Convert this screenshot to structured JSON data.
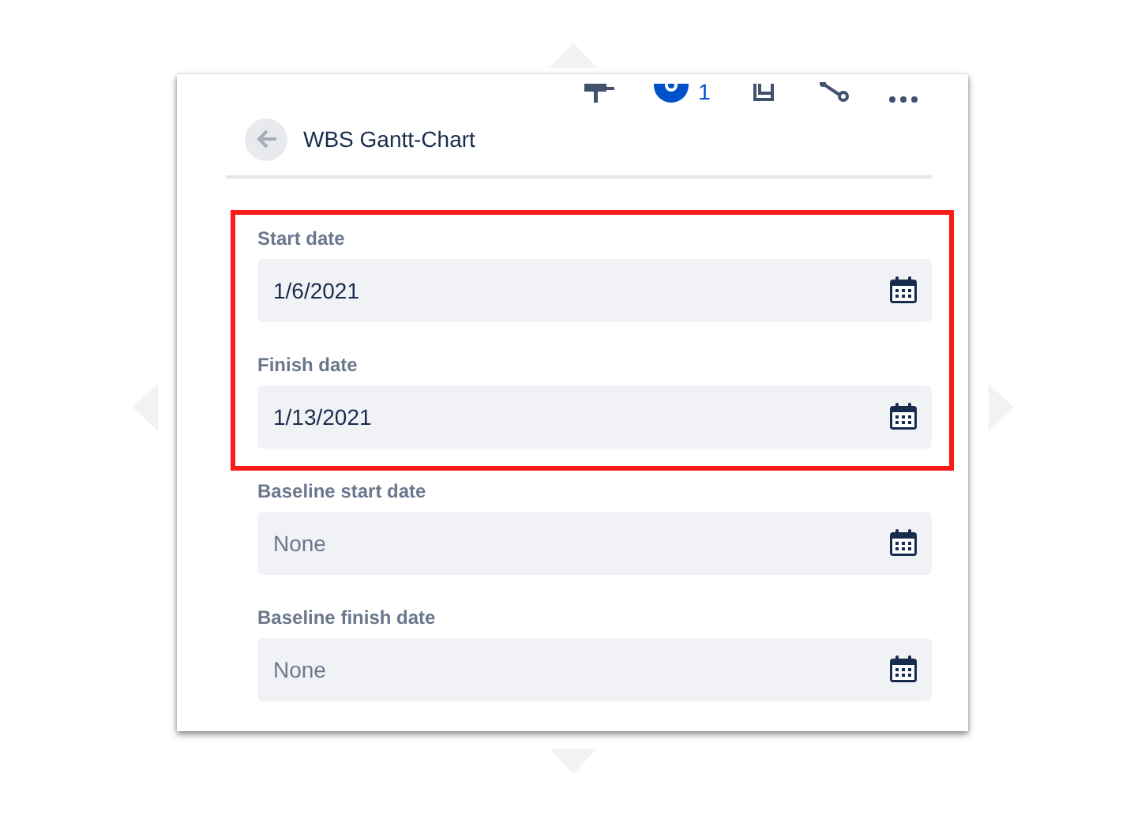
{
  "toolbar": {
    "watchers_count": "1"
  },
  "header": {
    "title": "WBS Gantt-Chart"
  },
  "fields": [
    {
      "label": "Start date",
      "value": "1/6/2021",
      "highlighted": true
    },
    {
      "label": "Finish date",
      "value": "1/13/2021",
      "highlighted": true
    },
    {
      "label": "Baseline start date",
      "placeholder": "None",
      "highlighted": false
    },
    {
      "label": "Baseline finish date",
      "placeholder": "None",
      "highlighted": false
    }
  ]
}
